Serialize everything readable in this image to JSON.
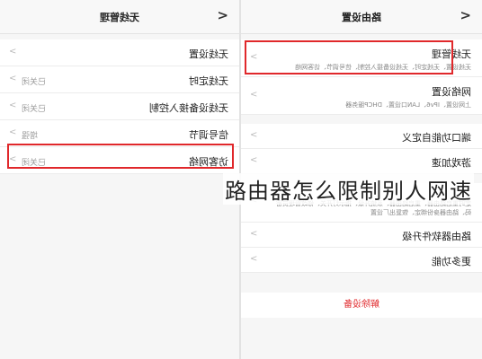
{
  "left": {
    "title": "无线管理",
    "rows": [
      {
        "label": "无线设置",
        "value": ""
      },
      {
        "label": "无线定时",
        "value": "已关闭"
      },
      {
        "label": "无线设备接入控制",
        "value": "已关闭"
      },
      {
        "label": "信号调节",
        "value": "增强"
      },
      {
        "label": "访客网络",
        "value": "已关闭"
      }
    ]
  },
  "right": {
    "title": "路由设置",
    "rows": [
      {
        "label": "无线管理",
        "sub": "无线设置、无线定时、无线设备接入控制、信号调节、访客网络"
      },
      {
        "label": "网络设置",
        "sub": "上网设置、IPv6、LAN口设置、DHCP服务器"
      },
      {
        "label": "端口功能自定义",
        "sub": ""
      },
      {
        "label": "游戏加速",
        "sub": ""
      },
      {
        "label": "",
        "sub": "定时重启路由器、重启路由器、系统升级、指示灯开关、修改管理员密码、路由器身份绑定、恢复出厂设置"
      },
      {
        "label": "路由器软件升级",
        "sub": ""
      },
      {
        "label": "更多功能",
        "sub": ""
      }
    ],
    "danger_label": "解除设备"
  },
  "caption": "路由器怎么限制别人网速",
  "back_glyph": "<",
  "chevron_glyph": ">"
}
